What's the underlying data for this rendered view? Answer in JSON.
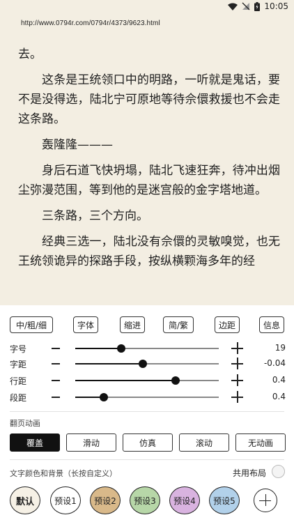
{
  "status": {
    "time": "10:05"
  },
  "url": "http://www.0794r.com/0794r/4373/9623.html",
  "article": {
    "paragraphs": [
      "去。",
      "这条是王统领口中的明路，一听就是鬼话，要不是没得选，陆北宁可原地等待佘儇救援也不会走这条路。",
      "轰隆隆———",
      "身后石道飞快坍塌，陆北飞速狂奔，待冲出烟尘弥漫范围，等到他的是迷宫般的金字塔地道。",
      "三条路，三个方向。",
      "经典三选一，陆北没有佘儇的灵敏嗅觉，也无王统领诡异的探路手段，按纵横颗海多年的经"
    ]
  },
  "tabs": [
    "中/粗/细",
    "字体",
    "缩进",
    "简/繁",
    "边距",
    "信息"
  ],
  "sliders": [
    {
      "label": "字号",
      "value": "19",
      "level": 0.32
    },
    {
      "label": "字距",
      "value": "-0.04",
      "level": 0.47
    },
    {
      "label": "行距",
      "value": "0.4",
      "level": 0.7
    },
    {
      "label": "段距",
      "value": "0.4",
      "level": 0.2
    }
  ],
  "page_anim": {
    "label": "翻页动画",
    "options": [
      "覆盖",
      "滑动",
      "仿真",
      "滚动",
      "无动画"
    ],
    "selected": "覆盖"
  },
  "text_color": {
    "label": "文字颜色和背景（长按自定义）",
    "shared_layout_label": "共用布局",
    "presets": [
      {
        "label": "默认",
        "color": "#f6f1e6"
      },
      {
        "label": "预设1",
        "color": "#ffffff"
      },
      {
        "label": "预设2",
        "color": "#d9b98a"
      },
      {
        "label": "预设3",
        "color": "#b7d7a8"
      },
      {
        "label": "预设4",
        "color": "#d9b3e0"
      },
      {
        "label": "预设5",
        "color": "#b2d1ea"
      }
    ]
  }
}
